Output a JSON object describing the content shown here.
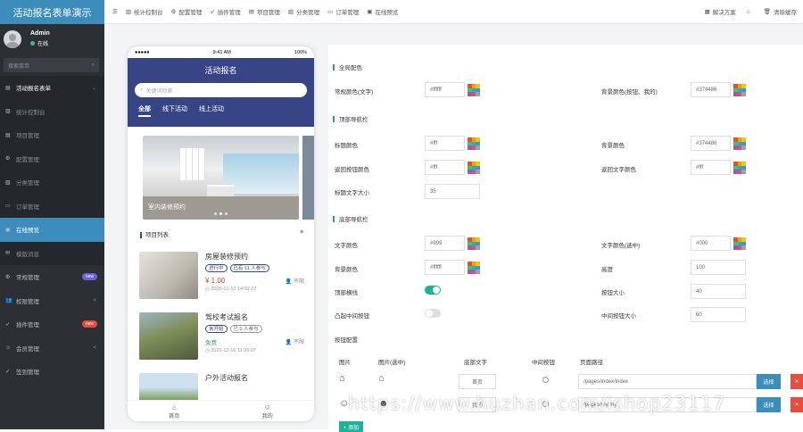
{
  "app": {
    "title": "活动报名表单演示"
  },
  "user": {
    "name": "Admin",
    "status": "在线"
  },
  "sidebar": {
    "search_placeholder": "搜索菜单",
    "items": [
      {
        "label": "活动报名表单",
        "icon": "list-icon",
        "type": "head"
      },
      {
        "label": "统计控制台",
        "icon": "dashboard-icon",
        "type": "sub"
      },
      {
        "label": "项目管理",
        "icon": "folder-icon",
        "type": "sub"
      },
      {
        "label": "配置管理",
        "icon": "gear-icon",
        "type": "sub"
      },
      {
        "label": "分类管理",
        "icon": "tags-icon",
        "type": "sub"
      },
      {
        "label": "订单管理",
        "icon": "order-icon",
        "type": "sub"
      },
      {
        "label": "在线预览",
        "icon": "preview-icon",
        "type": "active"
      },
      {
        "label": "模版消息",
        "icon": "mail-icon",
        "type": "sub"
      },
      {
        "label": "常规管理",
        "icon": "cogs-icon",
        "badge": "new",
        "badge_color": "#6c63d9"
      },
      {
        "label": "权限管理",
        "icon": "users-icon",
        "chevron": "<"
      },
      {
        "label": "插件管理",
        "icon": "plugin-icon",
        "badge": "new",
        "badge_color": "#e74c3c"
      },
      {
        "label": "会员管理",
        "icon": "member-icon",
        "chevron": "<"
      },
      {
        "label": "签到管理",
        "icon": "sign-icon"
      }
    ]
  },
  "topbar": {
    "menu_icon": "☰",
    "items": [
      {
        "label": "统计控制台",
        "icon": "▥"
      },
      {
        "label": "配置管理",
        "icon": "⚙"
      },
      {
        "label": "插件管理",
        "icon": "➶"
      },
      {
        "label": "项目管理",
        "icon": "▤"
      },
      {
        "label": "分类管理",
        "icon": "▧"
      },
      {
        "label": "订单管理",
        "icon": "▭"
      },
      {
        "label": "在线预览",
        "icon": "▣"
      }
    ],
    "right": [
      {
        "label": "解决方案",
        "icon": "▦"
      },
      {
        "label": "",
        "icon": "⌂"
      },
      {
        "label": "清除缓存",
        "icon": "🗑"
      }
    ]
  },
  "phone": {
    "time": "9:41 AM",
    "signal": "●●●●●",
    "battery": "100%",
    "title": "活动报名",
    "search_placeholder": "关键词检索",
    "tabs": [
      "全部",
      "线下活动",
      "线上活动"
    ],
    "banner_caption": "室内装修预约",
    "list_title": "项目列表",
    "items": [
      {
        "name": "房屋装修预约",
        "tags": [
          "进行中",
          "已有 11 人参与"
        ],
        "price": "¥ 1.00",
        "who": "不限",
        "time": "2020-12-10 14:02:22",
        "img_color": "#c9c6bd"
      },
      {
        "name": "驾校考试报名",
        "tags": [
          "未开始",
          "已 0 人参与"
        ],
        "price": "免费",
        "who": "不限",
        "time": "2020-12-10 11:26:07",
        "img_color": "#6b7a4d"
      },
      {
        "name": "户外活动报名",
        "tags": [],
        "price": "",
        "who": "",
        "time": "",
        "img_color": "#7aa55e"
      }
    ],
    "nav": [
      {
        "label": "首页",
        "icon": "⌂"
      },
      {
        "label": "我的",
        "icon": "☺"
      }
    ]
  },
  "form": {
    "sections": [
      "全局配色",
      "顶部导航栏",
      "底部导航栏"
    ],
    "fields": {
      "common_text_color": {
        "label": "常规颜色(文字)",
        "value": "#ffffff"
      },
      "bg_color": {
        "label": "背景颜色(按钮、我的)",
        "value": "#374486"
      },
      "title_color": {
        "label": "标题颜色",
        "value": "#fff"
      },
      "top_bg": {
        "label": "背景颜色",
        "value": "#374486"
      },
      "back_btn_color": {
        "label": "返回按钮颜色",
        "value": "#fff"
      },
      "back_text_color": {
        "label": "返回文字颜色",
        "value": "#fff"
      },
      "title_font_size": {
        "label": "标题文字大小",
        "value": "35"
      },
      "nav_text_color": {
        "label": "文字颜色",
        "value": "#999"
      },
      "nav_text_color_active": {
        "label": "文字颜色(选中)",
        "value": "#000"
      },
      "nav_bg": {
        "label": "背景颜色",
        "value": "#ffffff"
      },
      "height": {
        "label": "高度",
        "value": "100"
      },
      "top_border": {
        "label": "顶部横线",
        "value": "on"
      },
      "btn_size": {
        "label": "按钮大小",
        "value": "40"
      },
      "middle_btn": {
        "label": "凸起中间按钮",
        "value": "off"
      },
      "middle_btn_size": {
        "label": "中间按钮大小",
        "value": "60"
      }
    },
    "button_config_label": "按钮配置",
    "table_headers": [
      "图片",
      "图片(选中)",
      "底部文字",
      "中间按钮",
      "页面路径"
    ],
    "rows": [
      {
        "text": "首页",
        "path": "/pages/index/index",
        "choose": "选择",
        "del": "✕"
      },
      {
        "text": "我的",
        "path": "/pages/my/my",
        "choose": "选择",
        "del": "✕"
      }
    ],
    "add_label": "+ 添加"
  },
  "watermark": "https://www.huzhan.com/ishop23117"
}
